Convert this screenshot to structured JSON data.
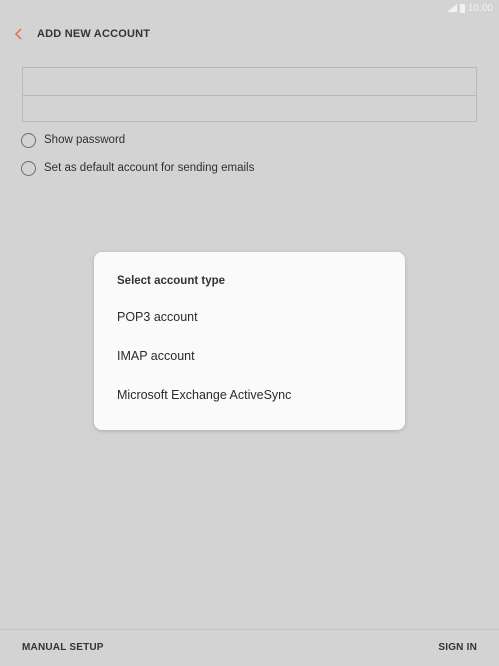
{
  "status_bar": {
    "time": "10:00",
    "icons": [
      "signal-icon",
      "battery-icon"
    ]
  },
  "header": {
    "title": "ADD NEW ACCOUNT",
    "back_icon": "chevron-left-icon",
    "accent_color": "#e8734d"
  },
  "form": {
    "email_value": "",
    "password_value": ""
  },
  "options": {
    "show_password": "Show password",
    "set_default": "Set as default account for sending emails"
  },
  "dialog": {
    "title": "Select account type",
    "items": [
      "POP3 account",
      "IMAP account",
      "Microsoft Exchange ActiveSync"
    ]
  },
  "footer": {
    "manual_setup": "MANUAL SETUP",
    "sign_in": "SIGN IN"
  }
}
